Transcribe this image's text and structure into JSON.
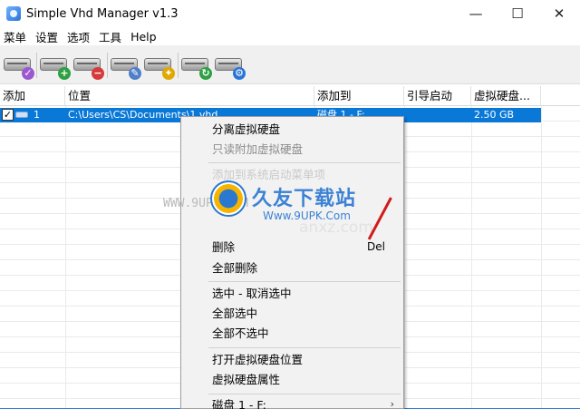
{
  "window": {
    "title": "Simple Vhd Manager v1.3",
    "controls": {
      "minimize": "—",
      "maximize": "☐",
      "close": "✕"
    }
  },
  "menu": [
    "菜单",
    "设置",
    "选项",
    "工具",
    "Help"
  ],
  "toolbar": {
    "buttons": [
      {
        "icon": "drive-check-icon",
        "badge_color": "#9b59d0"
      },
      {
        "icon": "drive-add-icon",
        "badge_color": "#2ea043"
      },
      {
        "icon": "drive-remove-icon",
        "badge_color": "#d63a3a"
      },
      {
        "icon": "drive-edit-icon",
        "badge_color": "#4f7fc9"
      },
      {
        "icon": "drive-wand-icon",
        "badge_color": "#e0a800"
      },
      {
        "icon": "drive-refresh-icon",
        "badge_color": "#2ea043"
      },
      {
        "icon": "drive-tools-icon",
        "badge_color": "#2a74d8"
      }
    ]
  },
  "table": {
    "columns": [
      "添加",
      "位置",
      "添加到",
      "引导启动",
      "虚拟硬盘..."
    ],
    "rows": [
      {
        "checked": "✓",
        "index": "1",
        "location": "C:\\Users\\CS\\Documents\\1.vhd",
        "attached_to": "磁盘 1 - F:",
        "boot": "",
        "size": "2.50 GB"
      }
    ]
  },
  "context_menu": {
    "items": [
      {
        "label": "分离虚拟硬盘",
        "state": "enabled"
      },
      {
        "label": "只读附加虚拟硬盘",
        "state": "disabled"
      },
      {
        "label": "添加到系统启动菜单项",
        "state": "faded"
      },
      {
        "label": "删除",
        "shortcut": "Del",
        "state": "enabled"
      },
      {
        "label": "全部删除",
        "state": "enabled"
      },
      {
        "label": "选中 - 取消选中",
        "state": "enabled"
      },
      {
        "label": "全部选中",
        "state": "enabled"
      },
      {
        "label": "全部不选中",
        "state": "enabled"
      },
      {
        "label": "打开虚拟硬盘位置",
        "state": "enabled"
      },
      {
        "label": "虚拟硬盘属性",
        "state": "enabled"
      },
      {
        "label": "磁盘 1 - F:",
        "submenu": "›",
        "state": "enabled"
      }
    ]
  },
  "watermark": {
    "url_text": "WWW.9UPK.COM",
    "brand": "久友下载站",
    "brand_url": "Www.9UPK.Com",
    "ghost": "anxz.com"
  },
  "colors": {
    "selection": "#0a78d7",
    "toolbar_bg": "#f0f0f0",
    "menu_bg": "#f2f2f2"
  }
}
